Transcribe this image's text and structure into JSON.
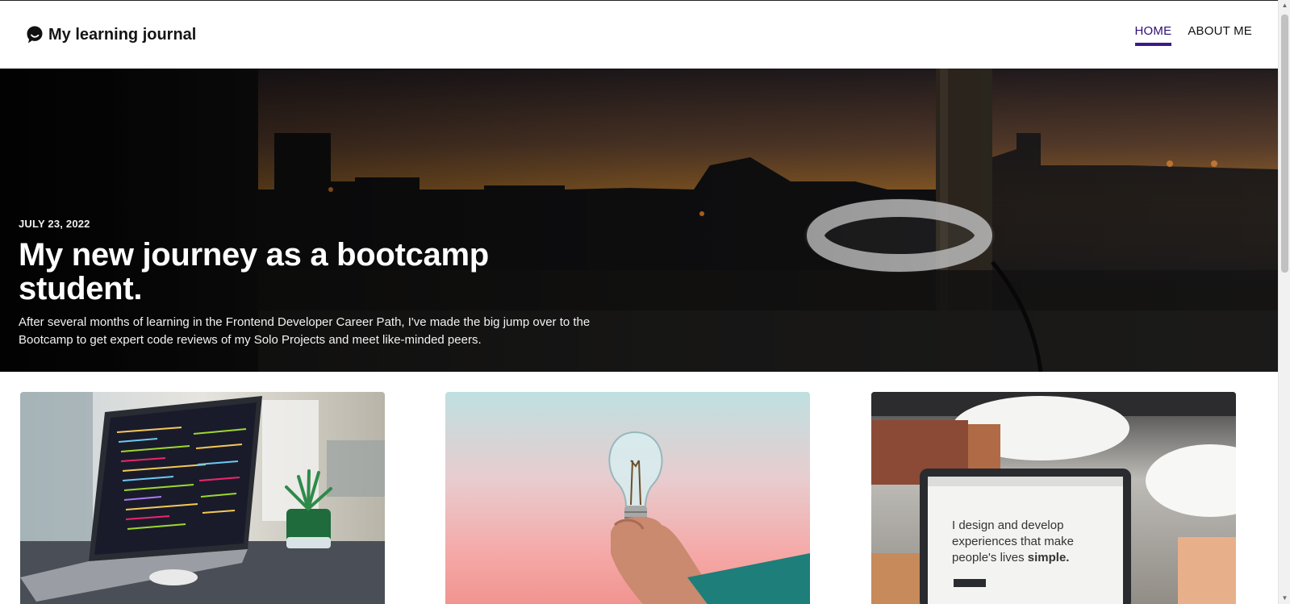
{
  "header": {
    "brand_title": "My learning journal",
    "brand_icon": "chat-bubble-icon",
    "nav": [
      {
        "label": "HOME",
        "active": true
      },
      {
        "label": "ABOUT ME",
        "active": false
      }
    ]
  },
  "hero": {
    "date": "JULY 23, 2022",
    "title": "My new journey as a bootcamp student.",
    "description": "After several months of learning in the Frontend Developer Career Path, I've made the big jump over to the Bootcamp to get expert code reviews of my Solo Projects and meet like-minded peers."
  },
  "cards": [
    {
      "image": "laptop-with-code-photo"
    },
    {
      "image": "lightbulb-in-hand-photo"
    },
    {
      "image": "laptop-portfolio-photo",
      "screen_text_1": "I design and develop",
      "screen_text_2": "experiences that make",
      "screen_text_3": "people's lives",
      "screen_text_bold": "simple."
    }
  ],
  "colors": {
    "accent": "#3a1a8a",
    "active_nav_text": "#2d0e73",
    "text": "#151515"
  }
}
